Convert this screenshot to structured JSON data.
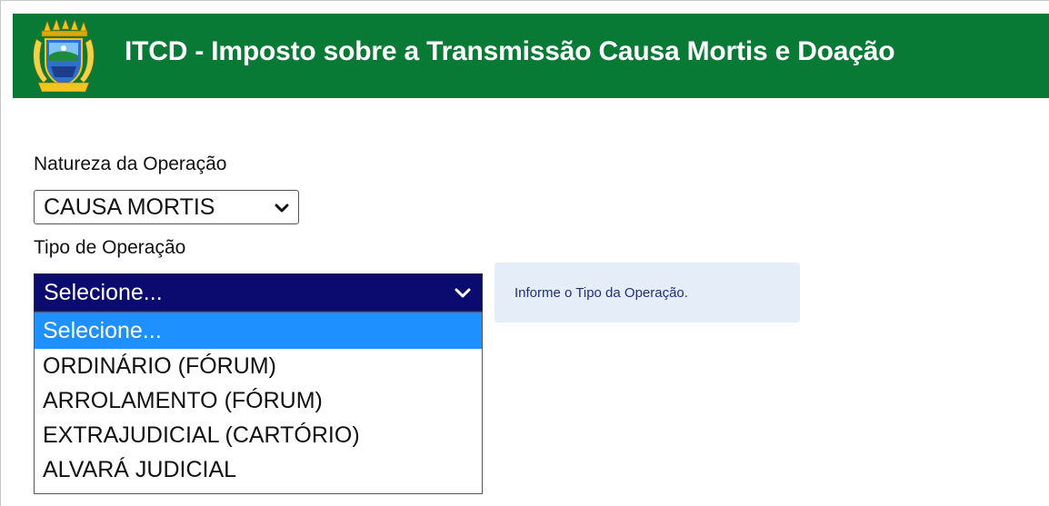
{
  "header": {
    "title": "ITCD - Imposto sobre a Transmissão Causa Mortis e Doação",
    "logo_icon": "state-coat-of-arms-icon",
    "background_color": "#087a36"
  },
  "form": {
    "natureza_label": "Natureza da Operação",
    "natureza_value": "CAUSA MORTIS",
    "tipo_label": "Tipo de Operação",
    "tipo_value": "Selecione...",
    "tipo_options": [
      "Selecione...",
      "ORDINÁRIO (FÓRUM)",
      "ARROLAMENTO (FÓRUM)",
      "EXTRAJUDICIAL (CARTÓRIO)",
      "ALVARÁ JUDICIAL"
    ],
    "tipo_highlight_color": "#1e90ff",
    "tooltip": "Informe o Tipo da Operação."
  }
}
